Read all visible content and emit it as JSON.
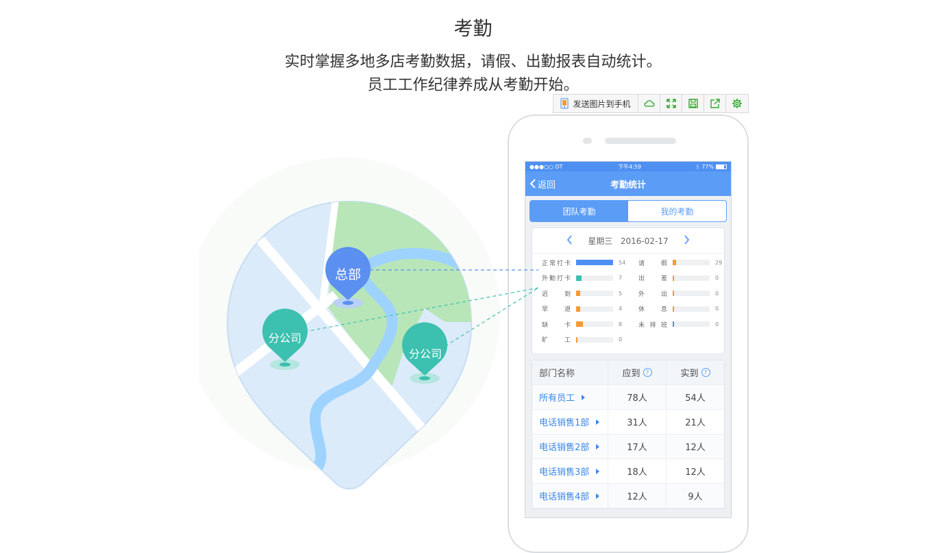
{
  "header": {
    "title": "考勤",
    "subtitle_line1": "实时掌握多地多店考勤数据，请假、出勤报表自动统计。",
    "subtitle_line2": "员工工作纪律养成从考勤开始。"
  },
  "toolbar": {
    "send_label": "发送图片到手机",
    "icons": [
      "cloud-icon",
      "expand-icon",
      "save-icon",
      "share-icon",
      "gear-icon"
    ],
    "accent": "#2aa52a"
  },
  "map": {
    "hq_label": "总部",
    "branch1_label": "分公司",
    "branch2_label": "分公司",
    "colors": {
      "hq": "#5b8ff0",
      "branch": "#3cc0b0",
      "water": "#9fd3ff",
      "land": "#dcebfa",
      "park": "#b8e6b8"
    }
  },
  "phone": {
    "status": {
      "carrier": "●●●○○ DT",
      "time": "下午4:59",
      "battery": "77%"
    },
    "nav": {
      "back_label": "返回",
      "title": "考勤统计"
    },
    "segments": {
      "team": "团队考勤",
      "mine": "我的考勤"
    },
    "date": {
      "weekday": "星期三",
      "date": "2016-02-17"
    },
    "stats_left": [
      {
        "label": "正常打卡",
        "value": "54",
        "ratio": 1.0,
        "color": "#4d8ff2"
      },
      {
        "label": "外勤打卡",
        "value": "7",
        "ratio": 0.15,
        "color": "#3cc0b0"
      },
      {
        "label": "迟到",
        "value": "5",
        "ratio": 0.12,
        "color": "#f39a34"
      },
      {
        "label": "早退",
        "value": "4",
        "ratio": 0.12,
        "color": "#f39a34"
      },
      {
        "label": "缺卡",
        "value": "8",
        "ratio": 0.18,
        "color": "#f39a34"
      },
      {
        "label": "旷工",
        "value": "0",
        "ratio": 0.03,
        "color": "#f39a34"
      }
    ],
    "stats_right": [
      {
        "label": "请假",
        "value": "29",
        "ratio": 0.1,
        "color": "#f39a34"
      },
      {
        "label": "出差",
        "value": "0",
        "ratio": 0.03,
        "color": "#f39a34"
      },
      {
        "label": "外出",
        "value": "0",
        "ratio": 0.03,
        "color": "#f39a34"
      },
      {
        "label": "休息",
        "value": "0",
        "ratio": 0.03,
        "color": "#f39a34"
      },
      {
        "label": "未排班",
        "value": "0",
        "ratio": 0.03,
        "color": "#4d8ff2"
      }
    ],
    "table": {
      "headers": [
        "部门名称",
        "应到",
        "实到"
      ],
      "rows": [
        {
          "dept": "所有员工",
          "expected": "78人",
          "actual": "54人"
        },
        {
          "dept": "电话销售1部",
          "expected": "31人",
          "actual": "21人"
        },
        {
          "dept": "电话销售2部",
          "expected": "17人",
          "actual": "12人"
        },
        {
          "dept": "电话销售3部",
          "expected": "18人",
          "actual": "12人"
        },
        {
          "dept": "电话销售4部",
          "expected": "12人",
          "actual": "9人"
        }
      ]
    }
  }
}
